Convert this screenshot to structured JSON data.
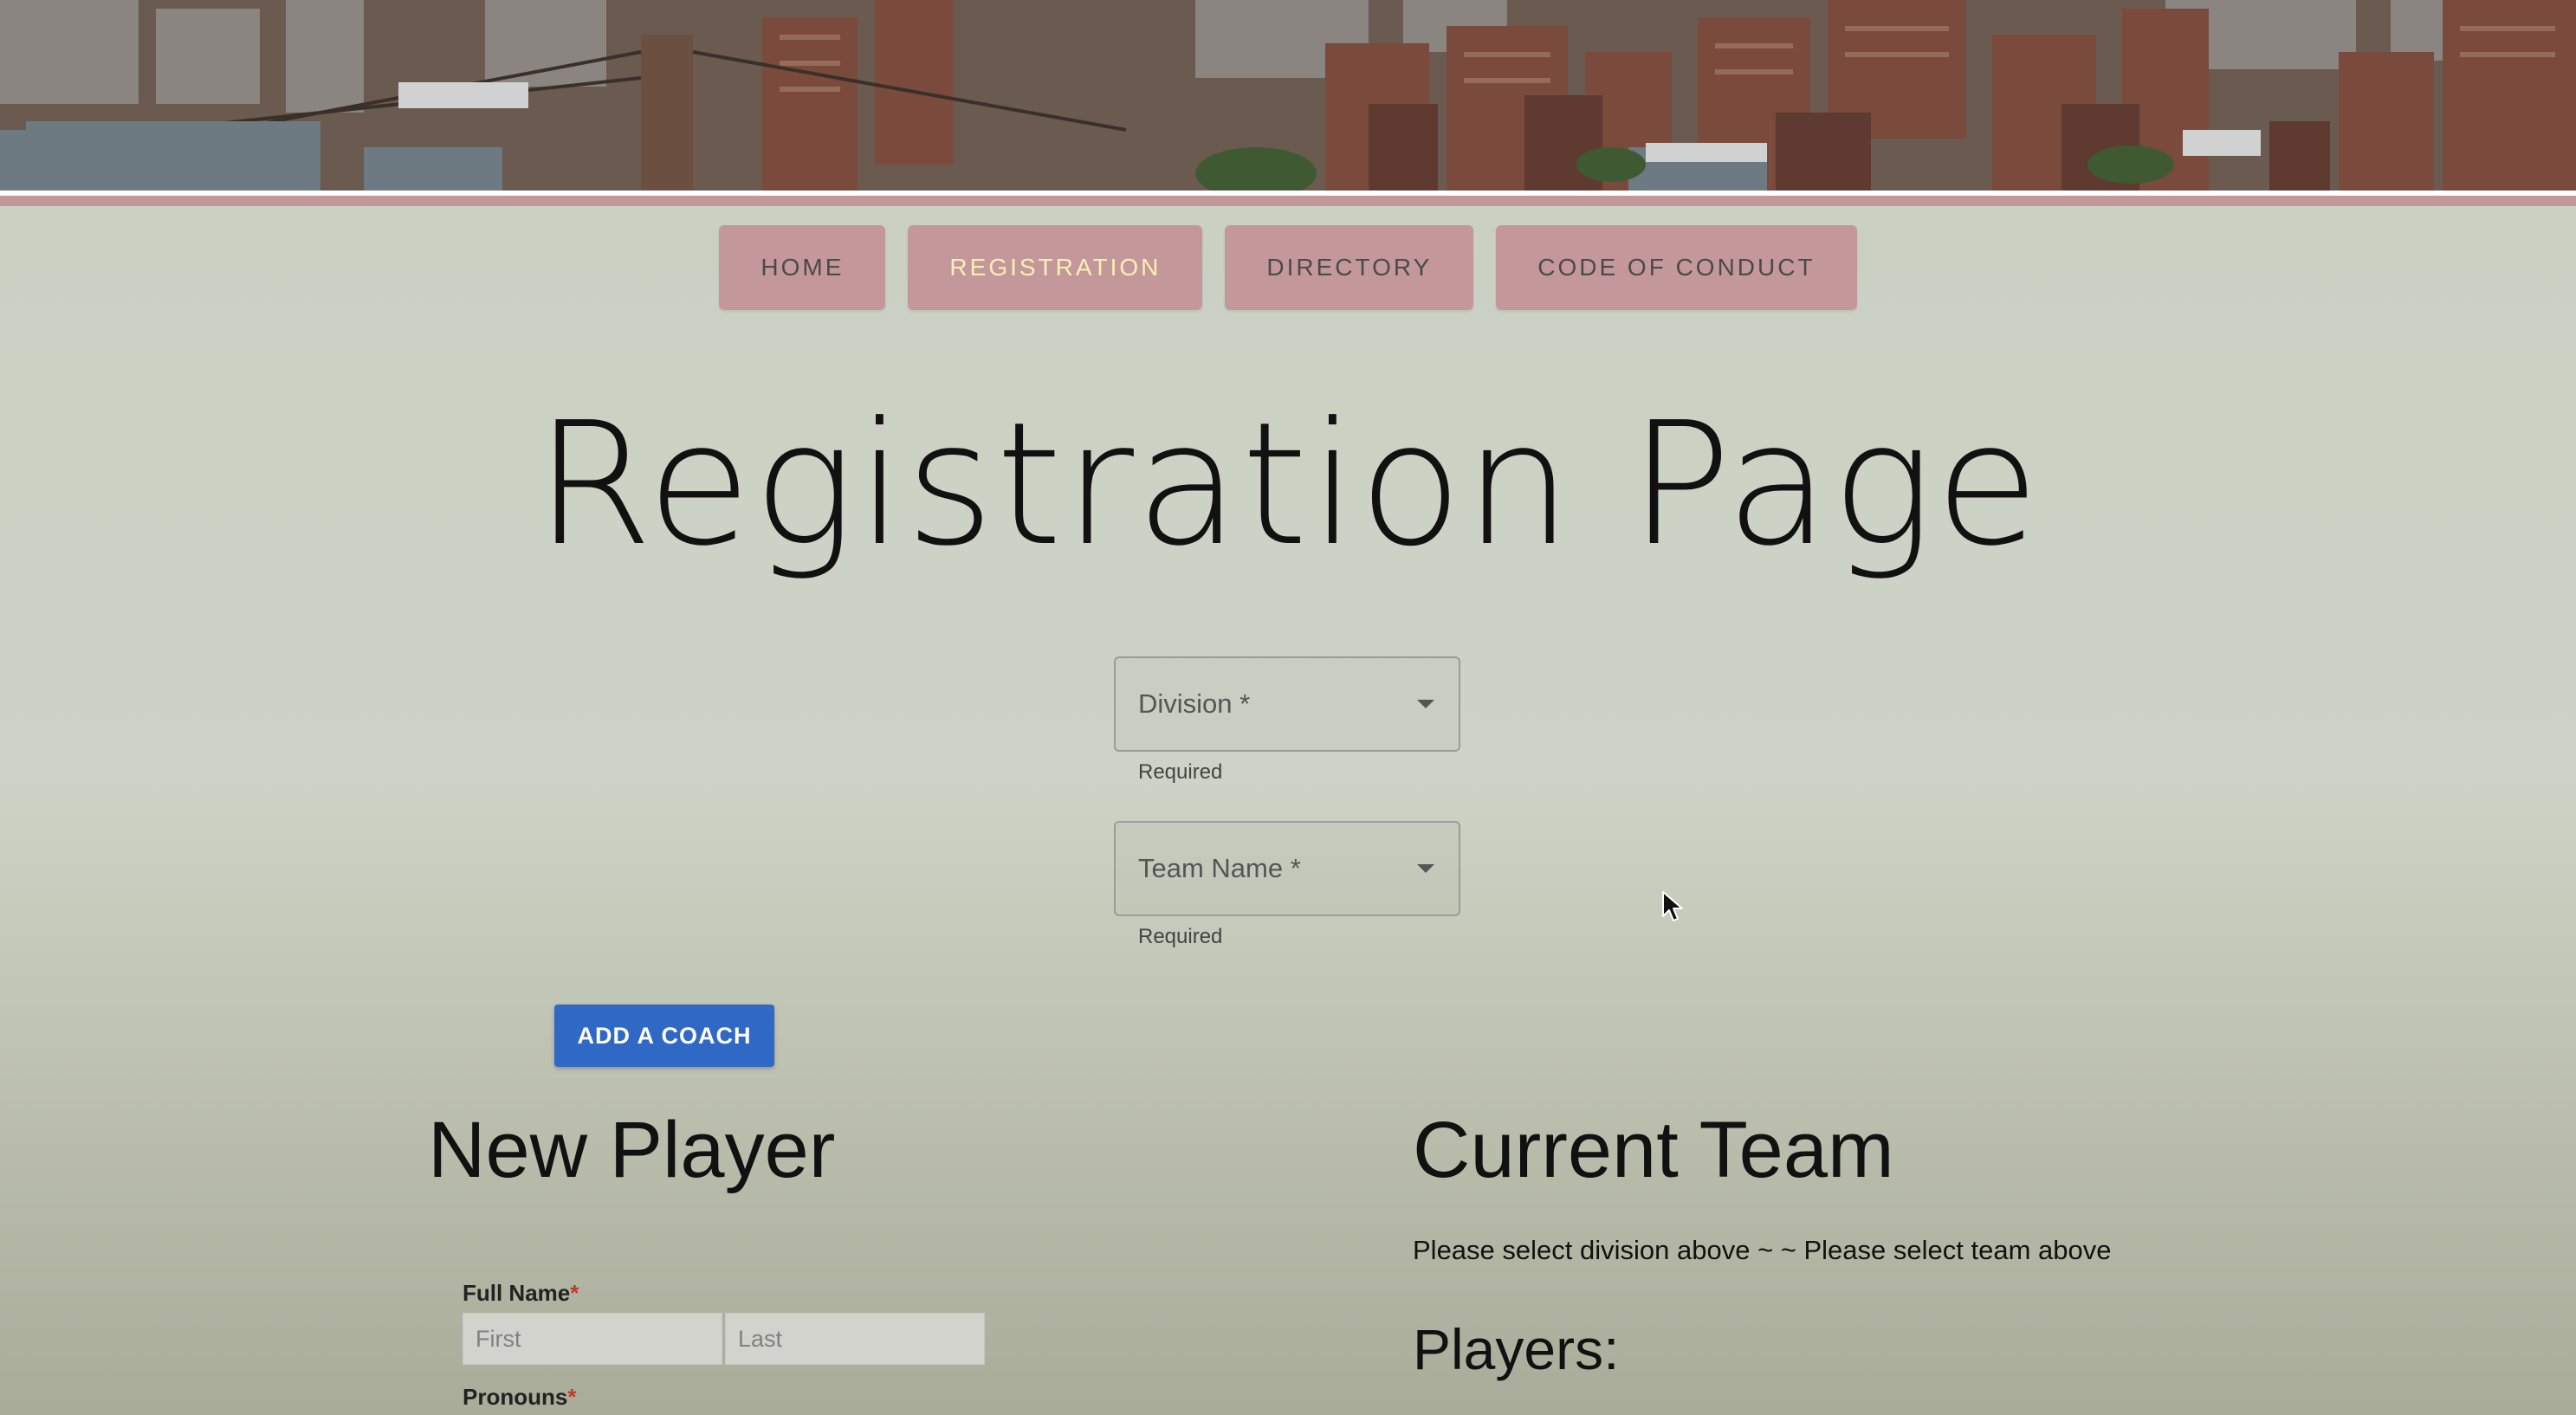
{
  "nav": {
    "items": [
      {
        "label": "HOME",
        "active": false
      },
      {
        "label": "REGISTRATION",
        "active": true
      },
      {
        "label": "DIRECTORY",
        "active": false
      },
      {
        "label": "CODE OF CONDUCT",
        "active": false
      }
    ]
  },
  "page_title": "Registration Page",
  "division_select": {
    "label": "Division *",
    "helper": "Required"
  },
  "team_select": {
    "label": "Team Name *",
    "helper": "Required"
  },
  "add_coach_label": "ADD A COACH",
  "new_player": {
    "heading": "New Player",
    "full_name_label": "Full Name",
    "first_placeholder": "First",
    "last_placeholder": "Last",
    "pronouns_label": "Pronouns",
    "required_marker": "*"
  },
  "current_team": {
    "heading": "Current Team",
    "status": "Please select division above ~ ~ Please select team above",
    "players_heading": "Players:"
  },
  "colors": {
    "nav_button": "#c4989b",
    "nav_active_text": "#f7f0b5",
    "primary_button": "#3068c6",
    "background": "#c9d0c2"
  }
}
